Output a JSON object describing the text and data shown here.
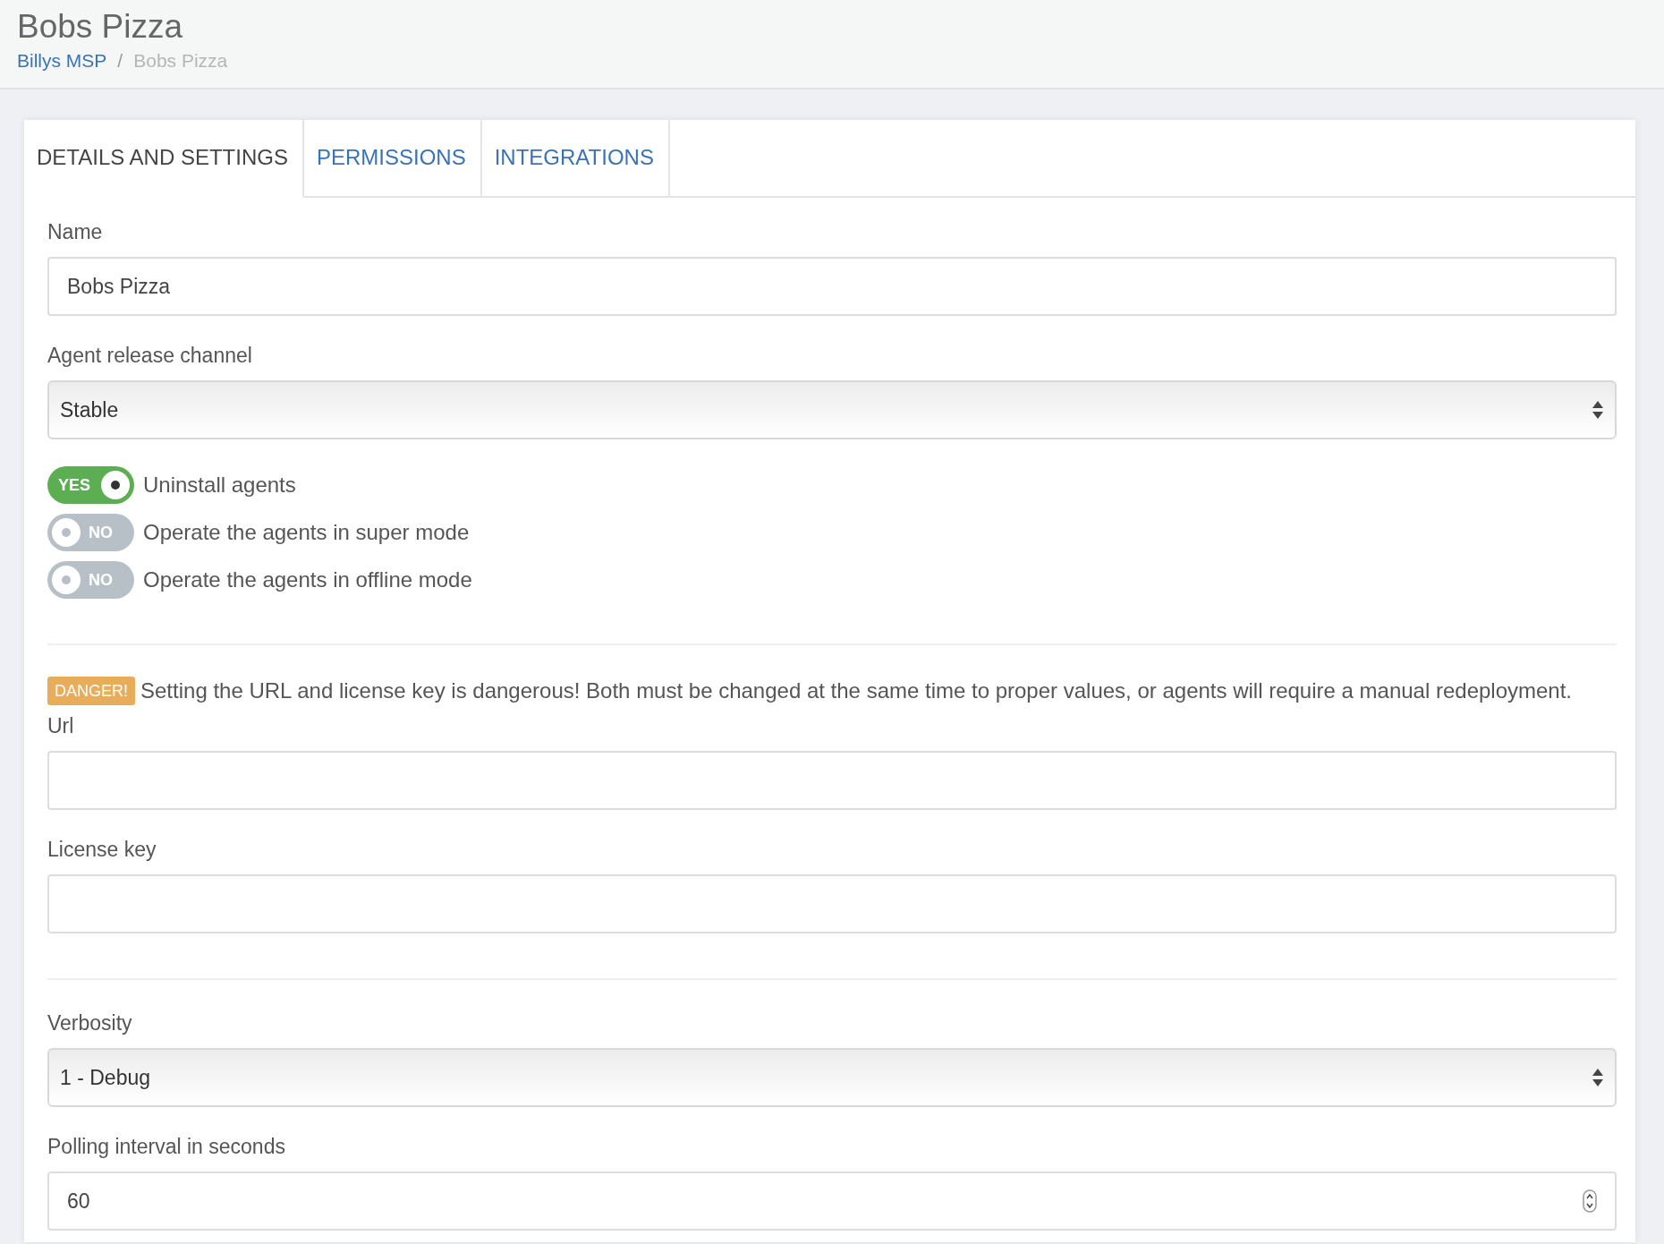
{
  "header": {
    "title": "Bobs Pizza",
    "breadcrumb": [
      {
        "label": "Billys MSP",
        "kind": "link"
      },
      {
        "label": "/",
        "kind": "separator"
      },
      {
        "label": "Bobs Pizza",
        "kind": "current"
      }
    ]
  },
  "tabs": [
    {
      "label": "DETAILS AND SETTINGS",
      "selected": true
    },
    {
      "label": "PERMISSIONS",
      "selected": false
    },
    {
      "label": "INTEGRATIONS",
      "selected": false
    }
  ],
  "form": {
    "items": [
      {
        "kind": "text",
        "label": "Name",
        "value": "Bobs Pizza"
      },
      {
        "kind": "select",
        "label": "Agent release channel",
        "value": "Stable"
      },
      {
        "kind": "toggle",
        "label": "Uninstall agents",
        "on": true,
        "state_text": "YES"
      },
      {
        "kind": "toggle",
        "label": "Operate the agents in super mode",
        "on": false,
        "state_text": "NO"
      },
      {
        "kind": "toggle",
        "label": "Operate the agents in offline mode",
        "on": false,
        "state_text": "NO"
      },
      {
        "kind": "divider"
      },
      {
        "kind": "warning",
        "badge": "DANGER!",
        "text": "Setting the URL and license key is dangerous! Both must be changed at the same time to proper values, or agents will require a manual redeployment."
      },
      {
        "kind": "text",
        "label": "Url"
      },
      {
        "kind": "text",
        "label": "License key"
      },
      {
        "kind": "divider"
      },
      {
        "kind": "select",
        "label": "Verbosity",
        "value": "1 - Debug"
      },
      {
        "kind": "number",
        "label": "Polling interval in seconds",
        "value": "60"
      }
    ]
  }
}
